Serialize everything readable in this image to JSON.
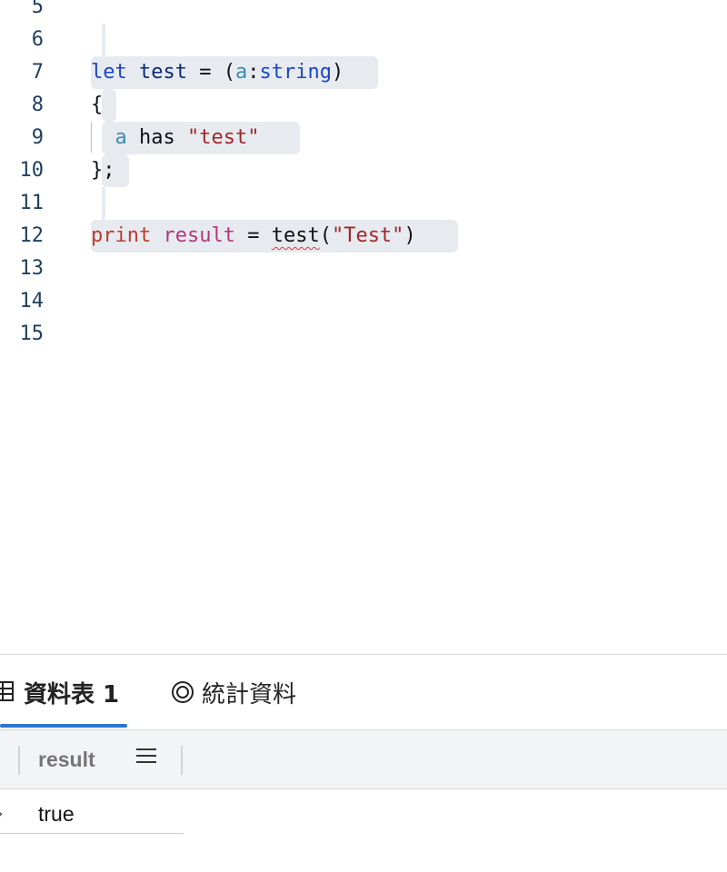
{
  "editor": {
    "line_numbers": [
      "5",
      "6",
      "7",
      "8",
      "9",
      "10",
      "11",
      "12",
      "13",
      "14",
      "15"
    ],
    "code": {
      "line7": {
        "kw": "let",
        "name": "test",
        "op": " = (",
        "param": "a",
        "colon": ":",
        "type": "string",
        "close": ")"
      },
      "line8": {
        "text": "{"
      },
      "line9": {
        "param": "a",
        "op": " has ",
        "str": "\"test\""
      },
      "line10": {
        "text": "};"
      },
      "line12": {
        "stmt": "print",
        "var": "result",
        "op": " = ",
        "fn": "test",
        "open": "(",
        "str": "\"Test\"",
        "close": ")"
      }
    }
  },
  "results": {
    "tabs": [
      {
        "label": "資料表 1",
        "icon": "table-icon",
        "active": true
      },
      {
        "label": "統計資料",
        "icon": "stats-ring-icon",
        "active": false
      }
    ],
    "columns": [
      {
        "label": "result"
      }
    ],
    "rows": [
      {
        "result": "true"
      }
    ]
  },
  "colors": {
    "accent": "#2b74d2",
    "error_squiggle": "#e53935",
    "selection_highlight": "#e7ebf0"
  }
}
